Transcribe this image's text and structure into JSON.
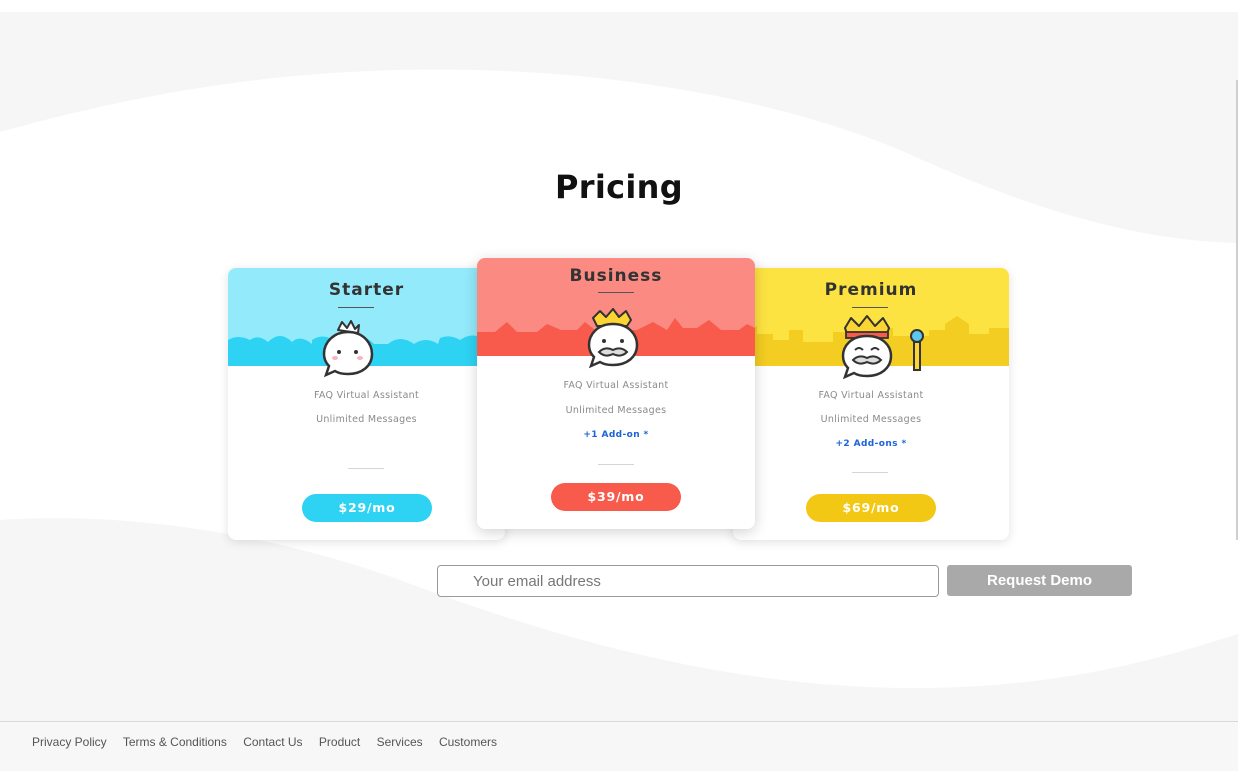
{
  "page": {
    "title": "Pricing"
  },
  "plans": [
    {
      "name": "Starter",
      "features": [
        "FAQ Virtual Assistant",
        "Unlimited Messages"
      ],
      "addon": "",
      "price": "$29/mo",
      "accent": "#2ed3f3"
    },
    {
      "name": "Business",
      "features": [
        "FAQ Virtual Assistant",
        "Unlimited Messages"
      ],
      "addon": "+1  Add-on *",
      "price": "$39/mo",
      "accent": "#f85a4c"
    },
    {
      "name": "Premium",
      "features": [
        "FAQ Virtual Assistant",
        "Unlimited Messages"
      ],
      "addon": "+2  Add-ons  *",
      "price": "$69/mo",
      "accent": "#f3c814"
    }
  ],
  "demo_form": {
    "email_placeholder": "Your email address",
    "email_value": "",
    "button_label": "Request Demo"
  },
  "footer": {
    "links": [
      "Privacy Policy",
      "Terms & Conditions",
      "Contact Us",
      "Product",
      "Services",
      "Customers"
    ]
  },
  "colors": {
    "starter_header": "#93eafb",
    "business_header": "#fb8a82",
    "premium_header": "#fde341",
    "button_gray": "#a9a9a9"
  }
}
